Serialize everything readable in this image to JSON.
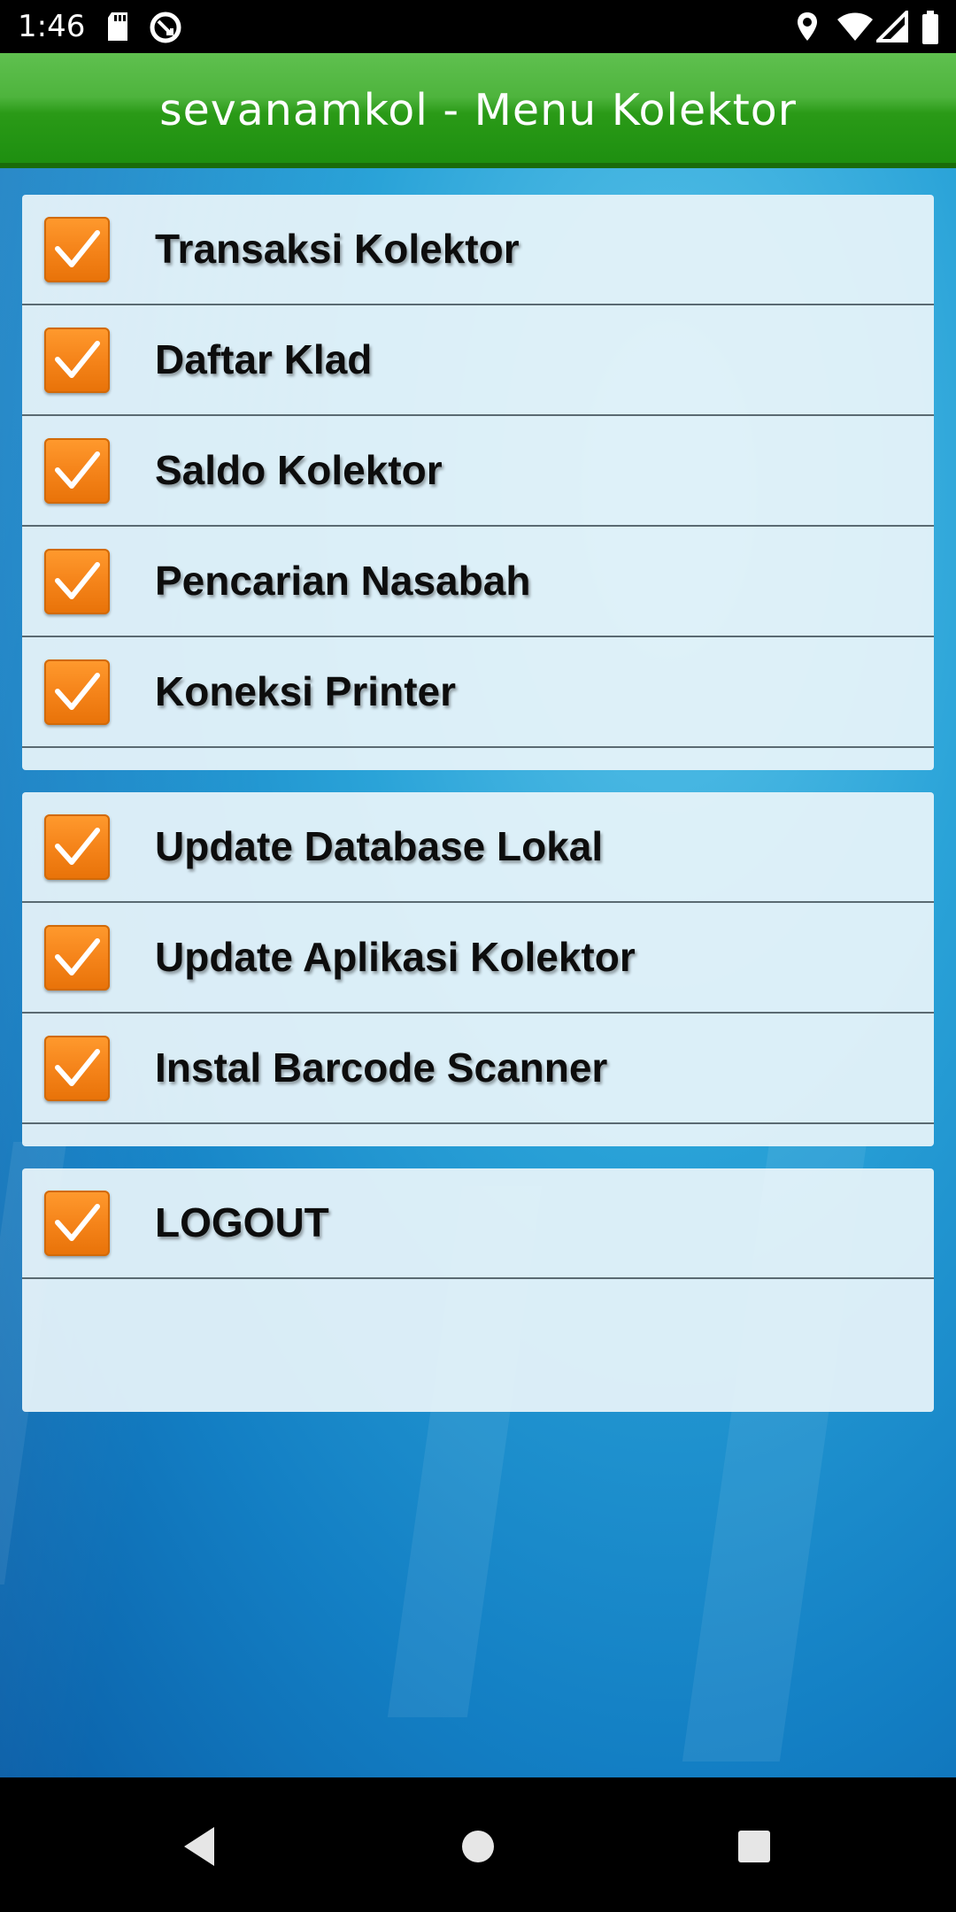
{
  "status_bar": {
    "time": "1:46",
    "icons": [
      "sd-card-icon",
      "sync-icon",
      "location-icon",
      "wifi-icon",
      "signal-icon",
      "battery-icon"
    ]
  },
  "action_bar": {
    "title": "sevanamkol - Menu Kolektor"
  },
  "colors": {
    "action_bar": "#2a9a17",
    "checkbox": "#f5841a",
    "card": "#e8f4fa"
  },
  "menu_groups": [
    {
      "items": [
        {
          "label": "Transaksi Kolektor",
          "checked": true
        },
        {
          "label": "Daftar Klad",
          "checked": true
        },
        {
          "label": "Saldo Kolektor",
          "checked": true
        },
        {
          "label": "Pencarian Nasabah",
          "checked": true
        },
        {
          "label": "Koneksi Printer",
          "checked": true
        }
      ]
    },
    {
      "items": [
        {
          "label": "Update Database Lokal",
          "checked": true
        },
        {
          "label": "Update Aplikasi Kolektor",
          "checked": true
        },
        {
          "label": "Instal Barcode Scanner",
          "checked": true
        }
      ]
    },
    {
      "items": [
        {
          "label": "LOGOUT",
          "checked": true
        }
      ]
    }
  ],
  "nav_bar": {
    "buttons": [
      "back-icon",
      "home-icon",
      "recents-icon"
    ]
  }
}
